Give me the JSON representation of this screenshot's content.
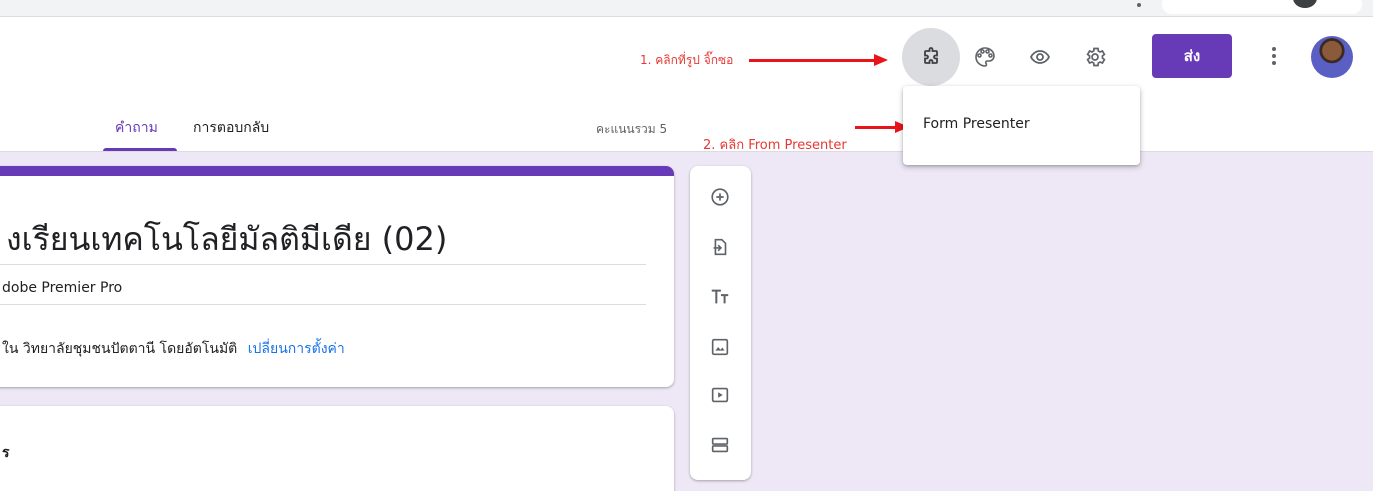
{
  "header": {
    "tabs": [
      {
        "label": "คำถาม",
        "active": true
      },
      {
        "label": "การตอบกลับ",
        "active": false
      }
    ],
    "total_points": "คะแนนรวม 5",
    "send_label": "ส่ง",
    "icons": [
      "puzzle-icon",
      "palette-icon",
      "eye-icon",
      "gear-icon",
      "more-vert-icon"
    ]
  },
  "annotations": {
    "step1": "1. คลิกที่รูป จิ๊กซอ",
    "step2": "2. คลิก From Presenter"
  },
  "addon_menu": {
    "items": [
      "Form Presenter"
    ]
  },
  "form": {
    "title": "งเรียนเทคโนโลยีมัลติมีเดีย (02)",
    "description": "dobe Premier Pro",
    "collect_note": "ใน วิทยาลัยชุมชนปัตตานี โดยอัตโนมัติ",
    "change_settings_link": "เปลี่ยนการตั้งค่า",
    "question_glyph": "ร"
  },
  "toolbar": {
    "tools": [
      "add-question-icon",
      "import-questions-icon",
      "add-title-icon",
      "add-image-icon",
      "add-video-icon",
      "add-section-icon"
    ]
  },
  "colors": {
    "accent": "#673ab7",
    "background": "#ede7f6",
    "annotation_red": "#e8141a",
    "link": "#1a73e8"
  }
}
